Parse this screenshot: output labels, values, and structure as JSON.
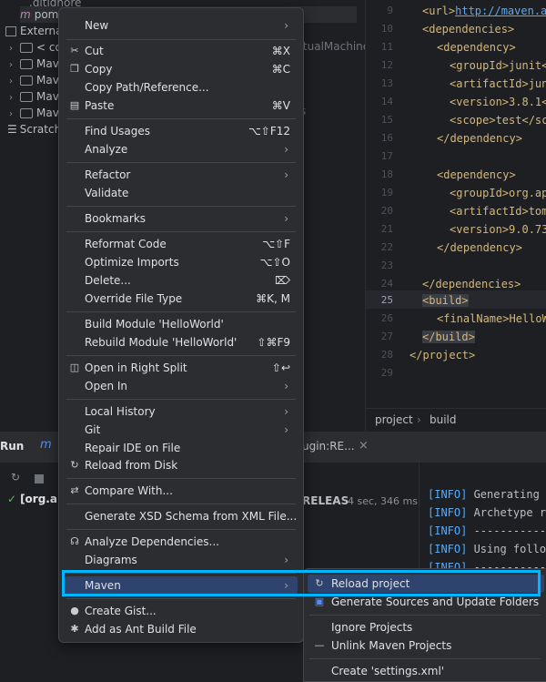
{
  "tree": {
    "top_items": [
      ".gitignore",
      "pom"
    ],
    "external_label": "Externa",
    "libs": [
      "< co",
      "Mav",
      "Mav",
      "Mav",
      "Mav"
    ],
    "scratch_label": "Scratch",
    "behind_text": "rtualMachine",
    "behind_text2": "s"
  },
  "editor": {
    "line_numbers": [
      "9",
      "10",
      "11",
      "12",
      "13",
      "14",
      "15",
      "16",
      "17",
      "18",
      "19",
      "20",
      "21",
      "22",
      "23",
      "24",
      "25",
      "26",
      "27",
      "28",
      "29"
    ],
    "url_open": "<url>",
    "url_value": "http://maven.a",
    "dependencies_open": "<dependencies>",
    "dependency_open": "<dependency>",
    "groupId_junit": "<groupId>junit<",
    "artifactId_junit": "<artifactId>jun",
    "version_junit": "<version>3.8.1<",
    "scope_test": "<scope>test</sc",
    "dependency_close": "</dependency>",
    "groupId_org": "<groupId>org.ap",
    "artifactId_tom": "<artifactId>tom",
    "version_9": "<version>9.0.73",
    "dependencies_close": "</dependencies>",
    "build_open": "<build>",
    "finalName": "<finalName>HelloW",
    "build_close": "</build>",
    "project_close": "</project>"
  },
  "breadcrumb": {
    "project": "project",
    "sep": "›",
    "build": "build"
  },
  "run": {
    "tab_run": "Run",
    "tab_m": "m",
    "tab_plugin": "ugin:RE...",
    "close": "×",
    "tree_item": "[org.ap",
    "release_text": "RELEAS",
    "timing": "4 sec, 346 ms",
    "console": [
      {
        "tag": "[INFO]",
        "text": " Generating"
      },
      {
        "tag": "[INFO]",
        "text": " Archetype r"
      },
      {
        "tag": "[INFO]",
        "text": " -----------"
      },
      {
        "tag": "[INFO]",
        "text": " Using follo"
      },
      {
        "tag": "[INFO]",
        "text": " -----------"
      }
    ]
  },
  "menu": {
    "new": "New",
    "cut": "Cut",
    "cut_sc": "⌘X",
    "copy": "Copy",
    "copy_sc": "⌘C",
    "copy_path": "Copy Path/Reference...",
    "paste": "Paste",
    "paste_sc": "⌘V",
    "find_usages": "Find Usages",
    "find_usages_sc": "⌥⇧F12",
    "analyze": "Analyze",
    "refactor": "Refactor",
    "validate": "Validate",
    "bookmarks": "Bookmarks",
    "reformat": "Reformat Code",
    "reformat_sc": "⌥⇧F",
    "optimize": "Optimize Imports",
    "optimize_sc": "⌥⇧O",
    "delete": "Delete...",
    "delete_sc": "⌦",
    "override": "Override File Type",
    "override_sc": "⌘K, M",
    "build_module": "Build Module 'HelloWorld'",
    "rebuild_module": "Rebuild Module 'HelloWorld'",
    "rebuild_sc": "⇧⌘F9",
    "open_right": "Open in Right Split",
    "open_right_sc": "⇧↩",
    "open_in": "Open In",
    "local_history": "Local History",
    "git": "Git",
    "repair_ide": "Repair IDE on File",
    "reload_disk": "Reload from Disk",
    "compare": "Compare With...",
    "generate_xsd": "Generate XSD Schema from XML File...",
    "analyze_deps": "Analyze Dependencies...",
    "diagrams": "Diagrams",
    "maven": "Maven",
    "create_gist": "Create Gist...",
    "add_ant": "Add as Ant Build File",
    "arrow": "›"
  },
  "submenu": {
    "reload_project": "Reload project",
    "generate_sources": "Generate Sources and Update Folders",
    "ignore_projects": "Ignore Projects",
    "unlink": "Unlink Maven Projects",
    "create_settings": "Create 'settings.xml'"
  },
  "colors": {
    "focus": "#00b5ff",
    "selection": "#2e436e"
  }
}
